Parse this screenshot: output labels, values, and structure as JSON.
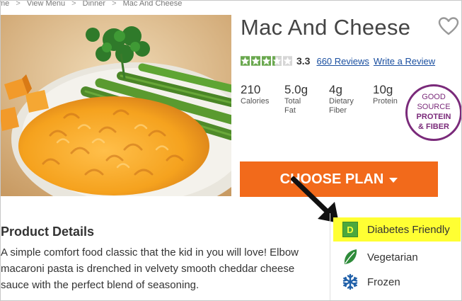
{
  "breadcrumb": {
    "items": [
      "me",
      "View Menu",
      "Dinner",
      "Mac And Cheese"
    ],
    "separator": ">"
  },
  "product": {
    "title": "Mac And Cheese",
    "rating_value": "3.3",
    "rating_stars": 3.3,
    "rating_max": 5,
    "reviews_link": "660 Reviews",
    "write_review_link": "Write a Review"
  },
  "nutrition": [
    {
      "value": "210",
      "label": "Calories"
    },
    {
      "value": "5.0g",
      "label": "Total\nFat"
    },
    {
      "value": "4g",
      "label": "Dietary\nFiber"
    },
    {
      "value": "10g",
      "label": "Protein"
    }
  ],
  "badge": {
    "line1": "GOOD",
    "line2": "SOURCE",
    "line3": "PROTEIN",
    "line4": "& FIBER"
  },
  "cta": {
    "label": "CHOOSE PLAN"
  },
  "details": {
    "title": "Product Details",
    "description": "A simple comfort food classic that the kid in you will love! Elbow macaroni pasta is drenched in velvety smooth cheddar cheese sauce with the perfect blend of seasoning."
  },
  "tags": [
    {
      "badge": "D",
      "label": "Diabetes Friendly",
      "icon": "diabetes-friendly-badge",
      "highlighted": true
    },
    {
      "label": "Vegetarian",
      "icon": "leaf-icon"
    },
    {
      "label": "Frozen",
      "icon": "snowflake-icon"
    }
  ],
  "colors": {
    "accent_orange": "#f26a1b",
    "link_blue": "#1a4fa0",
    "star_green": "#6aa84f",
    "badge_purple": "#7a2a7a",
    "highlight_yellow": "#ffff33",
    "leaf_green": "#2e8b3a",
    "snow_blue": "#1f5fa8"
  }
}
